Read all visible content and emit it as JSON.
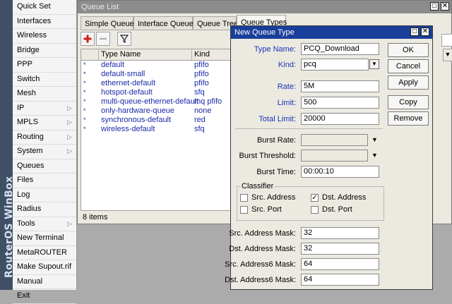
{
  "brand": "RouterOS WinBox",
  "menu": [
    {
      "label": "Quick Set",
      "submenu": false
    },
    {
      "label": "Interfaces",
      "submenu": false
    },
    {
      "label": "Wireless",
      "submenu": false
    },
    {
      "label": "Bridge",
      "submenu": false
    },
    {
      "label": "PPP",
      "submenu": false
    },
    {
      "label": "Switch",
      "submenu": false
    },
    {
      "label": "Mesh",
      "submenu": false
    },
    {
      "label": "IP",
      "submenu": true
    },
    {
      "label": "MPLS",
      "submenu": true
    },
    {
      "label": "Routing",
      "submenu": true
    },
    {
      "label": "System",
      "submenu": true
    },
    {
      "label": "Queues",
      "submenu": false
    },
    {
      "label": "Files",
      "submenu": false
    },
    {
      "label": "Log",
      "submenu": false
    },
    {
      "label": "Radius",
      "submenu": false
    },
    {
      "label": "Tools",
      "submenu": true
    },
    {
      "label": "New Terminal",
      "submenu": false
    },
    {
      "label": "MetaROUTER",
      "submenu": false
    },
    {
      "label": "Make Supout.rif",
      "submenu": false
    },
    {
      "label": "Manual",
      "submenu": false
    },
    {
      "label": "Exit",
      "submenu": false
    }
  ],
  "queue_window": {
    "title": "Queue List",
    "tabs": [
      "Simple Queues",
      "Interface Queues",
      "Queue Tree",
      "Queue Types"
    ],
    "active_tab": "Queue Types",
    "columns": [
      "Type Name",
      "Kind"
    ],
    "rows": [
      {
        "name": "default",
        "kind": "pfifo"
      },
      {
        "name": "default-small",
        "kind": "pfifo"
      },
      {
        "name": "ethernet-default",
        "kind": "pfifo"
      },
      {
        "name": "hotspot-default",
        "kind": "sfq"
      },
      {
        "name": "multi-queue-ethernet-default",
        "kind": "mq pfifo"
      },
      {
        "name": "only-hardware-queue",
        "kind": "none"
      },
      {
        "name": "synchronous-default",
        "kind": "red"
      },
      {
        "name": "wireless-default",
        "kind": "sfq"
      }
    ],
    "row_marker": "*",
    "status": "8 items"
  },
  "dialog": {
    "title": "New Queue Type",
    "type_name_label": "Type Name:",
    "type_name": "PCQ_Download",
    "kind_label": "Kind:",
    "kind": "pcq",
    "rate_label": "Rate:",
    "rate": "5M",
    "limit_label": "Limit:",
    "limit": "500",
    "total_limit_label": "Total Limit:",
    "total_limit": "20000",
    "burst_rate_label": "Burst Rate:",
    "burst_rate": "",
    "burst_threshold_label": "Burst Threshold:",
    "burst_threshold": "",
    "burst_time_label": "Burst Time:",
    "burst_time": "00:00:10",
    "classifier_label": "Classifier",
    "src_address_label": "Src. Address",
    "src_address_checked": false,
    "dst_address_label": "Dst. Address",
    "dst_address_checked": true,
    "src_port_label": "Src. Port",
    "src_port_checked": false,
    "dst_port_label": "Dst. Port",
    "dst_port_checked": false,
    "src_mask_label": "Src. Address Mask:",
    "src_mask": "32",
    "dst_mask_label": "Dst. Address Mask:",
    "dst_mask": "32",
    "src6_mask_label": "Src. Address6 Mask:",
    "src6_mask": "64",
    "dst6_mask_label": "Dst. Address6 Mask:",
    "dst6_mask": "64",
    "buttons": {
      "ok": "OK",
      "cancel": "Cancel",
      "apply": "Apply",
      "copy": "Copy",
      "remove": "Remove"
    }
  },
  "icons": {
    "add": "plus-icon",
    "remove": "minus-icon",
    "filter": "funnel-icon"
  },
  "colors": {
    "link_text": "#1a2aa8",
    "label_blue": "#1a34b6",
    "title_active": "#193f9a",
    "title_inactive": "#8c8c8c",
    "brand_bar": "#3f4f66"
  }
}
